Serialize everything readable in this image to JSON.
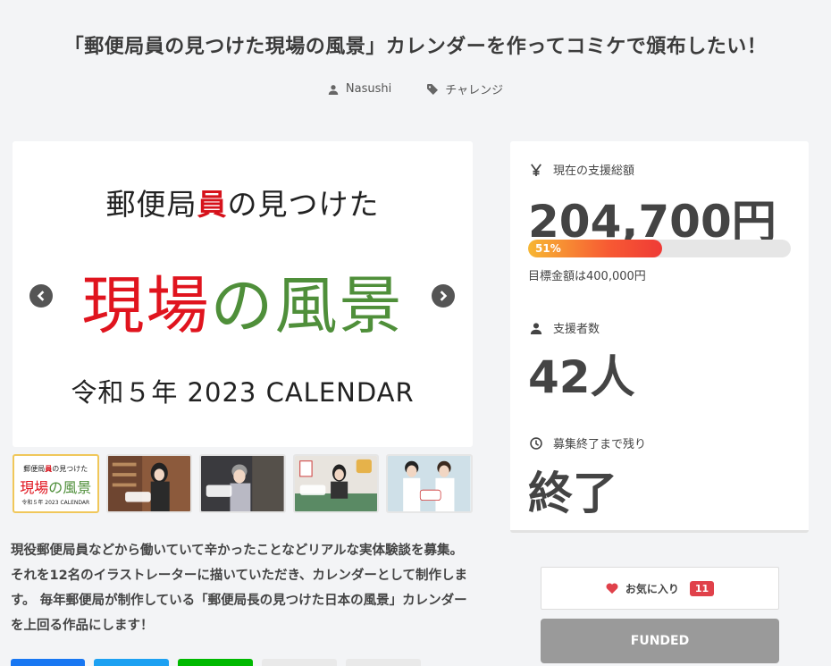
{
  "project": {
    "title": "「郵便局員の見つけた現場の風景」カレンダーを作ってコミケで頒布したい！",
    "author": "Nasushi",
    "category": "チャレンジ"
  },
  "hero": {
    "line1_a": "郵便局",
    "line1_b": "員",
    "line1_c": "の見つけた",
    "line2_a": "現場",
    "line2_b": "の",
    "line2_c": "風景",
    "line3": "令和５年 2023 CALENDAR"
  },
  "thumbs": {
    "t1_line1_a": "郵便局",
    "t1_line1_b": "員",
    "t1_line1_c": "の見つけた",
    "t1_line2_a": "現場",
    "t1_line2_b": "の",
    "t1_line2_c": "風景",
    "t1_line3": "令和５年 2023 CALENDAR"
  },
  "description": "現役郵便局員などから働いていて辛かったことなどリアルな実体験談を募集。 それを12名のイラストレーターに描いていただき、カレンダーとして制作します。 毎年郵便局が制作している「郵便局長の見つけた日本の風景」カレンダーを上回る作品にします！",
  "stats": {
    "funding_label": "現在の支援総額",
    "funding_amount": "204,700円",
    "progress_percent": 51,
    "progress_label": "51%",
    "goal_text": "目標金額は400,000円",
    "backers_label": "支援者数",
    "backers_count": "42人",
    "remaining_label": "募集終了まで残り",
    "remaining_value": "終了"
  },
  "actions": {
    "favorite_label": "お気に入り",
    "favorite_count": "11",
    "funded_label": "FUNDED"
  },
  "colors": {
    "accent_red": "#e0414a",
    "funded_gray": "#9a9a9a",
    "share_facebook": "#1877f2",
    "share_twitter": "#1da1f2",
    "share_line": "#00b900"
  },
  "icons": {
    "author": "user-icon",
    "category": "tag-icon",
    "funding": "yen-icon",
    "backers": "user-icon",
    "remaining": "clock-icon",
    "favorite": "heart-icon"
  }
}
